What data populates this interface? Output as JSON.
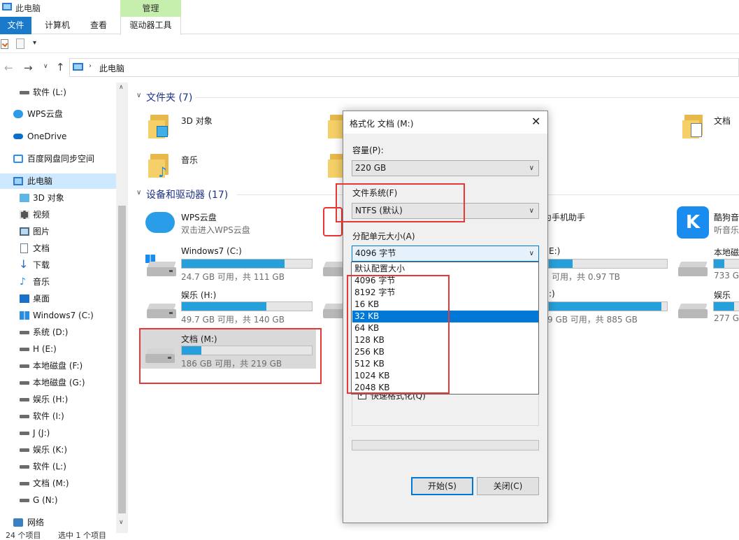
{
  "window": {
    "title": "此电脑"
  },
  "ribbon": {
    "context_header": "管理",
    "tabs": [
      "文件",
      "计算机",
      "查看",
      "驱动器工具"
    ]
  },
  "address": {
    "path": "此电脑"
  },
  "nav": {
    "items": [
      {
        "label": "软件 (L:)"
      },
      {
        "label": "WPS云盘"
      },
      {
        "label": "OneDrive"
      },
      {
        "label": "百度网盘同步空间"
      },
      {
        "label": "此电脑"
      },
      {
        "label": "3D 对象"
      },
      {
        "label": "视频"
      },
      {
        "label": "图片"
      },
      {
        "label": "文档"
      },
      {
        "label": "下载"
      },
      {
        "label": "音乐"
      },
      {
        "label": "桌面"
      },
      {
        "label": "Windows7 (C:)"
      },
      {
        "label": "系统 (D:)"
      },
      {
        "label": "H (E:)"
      },
      {
        "label": "本地磁盘 (F:)"
      },
      {
        "label": "本地磁盘 (G:)"
      },
      {
        "label": "娱乐 (H:)"
      },
      {
        "label": "软件 (I:)"
      },
      {
        "label": "J (J:)"
      },
      {
        "label": "娱乐 (K:)"
      },
      {
        "label": "软件 (L:)"
      },
      {
        "label": "文档 (M:)"
      },
      {
        "label": "G (N:)"
      },
      {
        "label": "网络"
      }
    ]
  },
  "status": {
    "count": "24 个项目",
    "selected": "选中 1 个项目"
  },
  "folders": {
    "header": "文件夹 (7)",
    "items": [
      "3D 对象",
      "音乐",
      "文档"
    ]
  },
  "devices": {
    "header": "设备和驱动器 (17)",
    "wps": {
      "name": "WPS云盘",
      "sub": "双击进入WPS云盘"
    },
    "phone": {
      "name": "为手机助手"
    },
    "kugou": {
      "name": "酷狗音",
      "sub": "听音乐"
    },
    "drives": [
      {
        "name": "Windows7 (C:)",
        "free": "24.7 GB 可用，共 111 GB",
        "fill": 0.79
      },
      {
        "name": "娱乐 (H:)",
        "free": "49.7 GB 可用，共 140 GB",
        "fill": 0.65
      },
      {
        "name": "文档 (M:)",
        "free": "186 GB 可用，共 219 GB",
        "fill": 0.15
      },
      {
        "name": "E:)",
        "free": "可用，共 0.97 TB",
        "fill": 0.2
      },
      {
        "name": ":)",
        "free": "9 GB 可用，共 885 GB",
        "fill": 0.95
      },
      {
        "name": "本地磁",
        "free": "733 GB",
        "fill": 0.25
      },
      {
        "name": "娱乐",
        "free": "277 GB",
        "fill": 0.5
      }
    ]
  },
  "dialog": {
    "title": "格式化 文档 (M:)",
    "capacity_label": "容量(P):",
    "capacity_value": "220 GB",
    "fs_label": "文件系统(F)",
    "fs_value": "NTFS (默认)",
    "alloc_label": "分配单元大小(A)",
    "alloc_value": "4096 字节",
    "options": [
      "默认配置大小",
      "4096 字节",
      "8192 字节",
      "16 KB",
      "32 KB",
      "64 KB",
      "128 KB",
      "256 KB",
      "512 KB",
      "1024 KB",
      "2048 KB"
    ],
    "selected_option": "32 KB",
    "quick_format": "快速格式化(Q)",
    "start_button": "开始(S)",
    "close_button": "关闭(C)"
  }
}
